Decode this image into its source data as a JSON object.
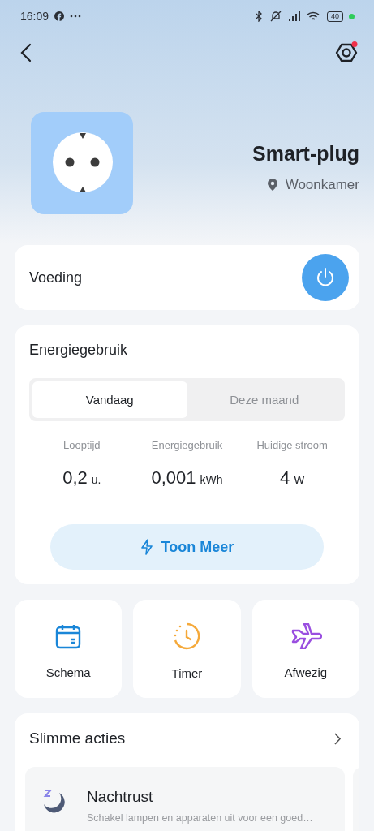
{
  "status_bar": {
    "time": "16:09",
    "battery": "40"
  },
  "device": {
    "name": "Smart-plug",
    "room": "Woonkamer",
    "settings_badge": true
  },
  "power": {
    "label": "Voeding",
    "on": true
  },
  "energy": {
    "title": "Energiegebruik",
    "tabs": [
      {
        "label": "Vandaag",
        "selected": true
      },
      {
        "label": "Deze maand",
        "selected": false
      }
    ],
    "stats": [
      {
        "label": "Looptijd",
        "value": "0,2",
        "unit": "u."
      },
      {
        "label": "Energiegebruik",
        "value": "0,001",
        "unit": "kWh"
      },
      {
        "label": "Huidige stroom",
        "value": "4",
        "unit": "W"
      }
    ],
    "more_button": "Toon Meer"
  },
  "features": [
    {
      "kind": "calendar",
      "label": "Schema"
    },
    {
      "kind": "clock",
      "label": "Timer"
    },
    {
      "kind": "plane",
      "label": "Afwezig"
    }
  ],
  "smart_actions": {
    "title": "Slimme acties",
    "items": [
      {
        "kind": "moon",
        "title": "Nachtrust",
        "description": "Schakel lampen en apparaten uit voor een goed…"
      }
    ]
  }
}
